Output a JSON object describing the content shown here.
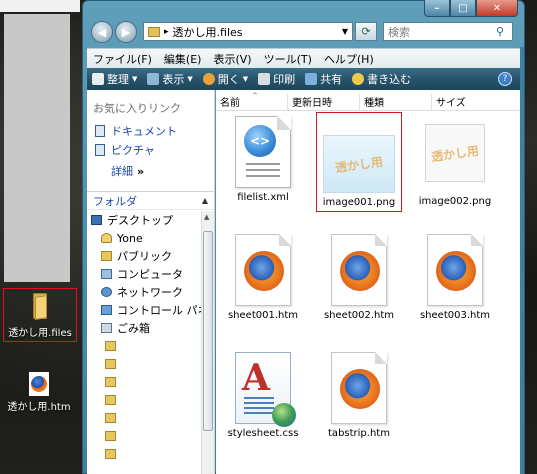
{
  "desktop": {
    "folder_icon_label": "透かし用.files",
    "htm_icon_label": "透かし用.htm"
  },
  "window": {
    "controls": {
      "minimize": "–",
      "maximize": "□",
      "close": "✕"
    },
    "address": {
      "path": "透かし用.files"
    },
    "search": {
      "placeholder": "検索"
    },
    "menu": [
      "ファイル(F)",
      "編集(E)",
      "表示(V)",
      "ツール(T)",
      "ヘルプ(H)"
    ],
    "toolbar": {
      "organize": "整理",
      "views": "表示",
      "open": "開く",
      "print": "印刷",
      "share": "共有",
      "burn": "書き込む"
    },
    "nav": {
      "favorites_heading": "お気に入りリンク",
      "favorites": [
        "ドキュメント",
        "ピクチャ"
      ],
      "more": "詳細",
      "more_glyph": "»",
      "folders_heading": "フォルダ",
      "tree": [
        "デスクトップ",
        "Yone",
        "パブリック",
        "コンピュータ",
        "ネットワーク",
        "コントロール パネ",
        "ごみ箱"
      ]
    },
    "columns": [
      "名前",
      "更新日時",
      "種類",
      "サイズ"
    ],
    "files": [
      {
        "name": "filelist.xml",
        "type": "xml"
      },
      {
        "name": "image001.png",
        "type": "image-light",
        "selected": true,
        "watermark": "透かし用"
      },
      {
        "name": "image002.png",
        "type": "image-plain",
        "watermark": "透かし用"
      },
      {
        "name": "sheet001.htm",
        "type": "firefox"
      },
      {
        "name": "sheet002.htm",
        "type": "firefox"
      },
      {
        "name": "sheet003.htm",
        "type": "firefox"
      },
      {
        "name": "stylesheet.css",
        "type": "css"
      },
      {
        "name": "tabstrip.htm",
        "type": "firefox"
      }
    ]
  },
  "colors": {
    "selection_border": "#cc1b1b",
    "link_blue": "#1a47a6",
    "toolbar_dark": "#27546b",
    "window_frame": "#3f7fa0"
  }
}
